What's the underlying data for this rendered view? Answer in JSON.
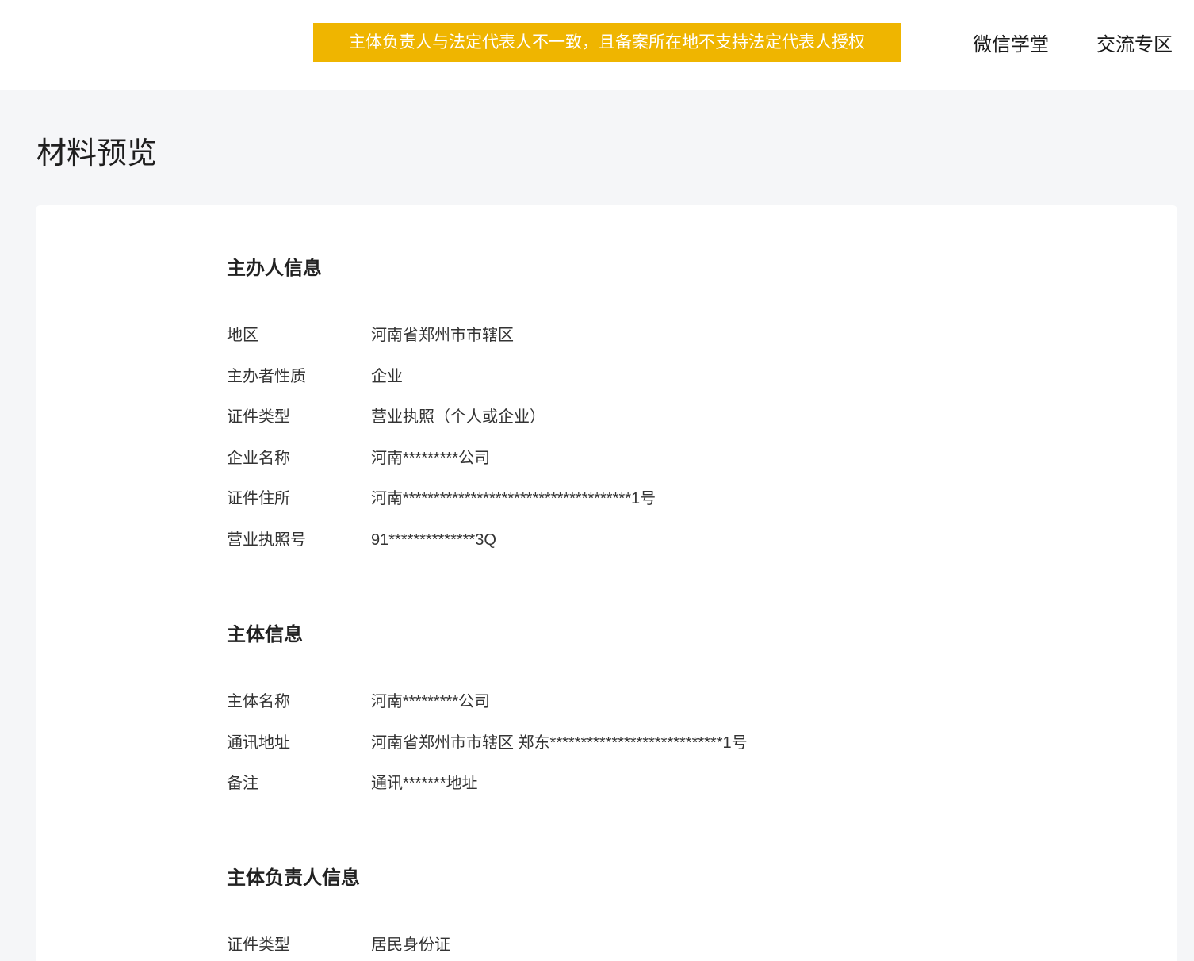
{
  "header": {
    "banner_text": "主体负责人与法定代表人不一致，且备案所在地不支持法定代表人授权",
    "nav": [
      {
        "label": "微信学堂"
      },
      {
        "label": "交流专区"
      }
    ]
  },
  "page": {
    "title": "材料预览"
  },
  "sections": [
    {
      "title": "主办人信息",
      "rows": [
        {
          "label": "地区",
          "value": "河南省郑州市市辖区"
        },
        {
          "label": "主办者性质",
          "value": "企业"
        },
        {
          "label": "证件类型",
          "value": "营业执照（个人或企业）"
        },
        {
          "label": "企业名称",
          "value": "河南*********公司"
        },
        {
          "label": "证件住所",
          "value": "河南*************************************1号"
        },
        {
          "label": "营业执照号",
          "value": "91**************3Q"
        }
      ]
    },
    {
      "title": "主体信息",
      "rows": [
        {
          "label": "主体名称",
          "value": "河南*********公司"
        },
        {
          "label": "通讯地址",
          "value": "河南省郑州市市辖区 郑东****************************1号"
        },
        {
          "label": "备注",
          "value": "通讯*******地址"
        }
      ]
    },
    {
      "title": "主体负责人信息",
      "rows": [
        {
          "label": "证件类型",
          "value": "居民身份证"
        }
      ]
    }
  ],
  "colors": {
    "banner_background": "#efb500",
    "banner_text": "#ffffff",
    "page_background": "#f5f6f8",
    "card_background": "#ffffff"
  }
}
